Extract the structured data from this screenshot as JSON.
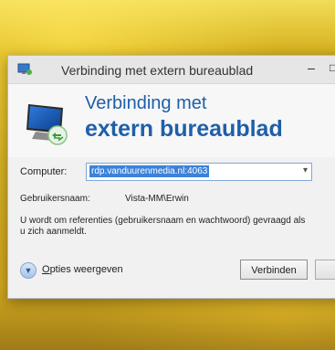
{
  "window": {
    "title": "Verbinding met extern bureaublad",
    "minimize_glyph": "–",
    "maximize_glyph": "□"
  },
  "banner": {
    "line1": "Verbinding met",
    "line2": "extern bureaublad",
    "icon": "remote-desktop-monitor-icon"
  },
  "form": {
    "computer_label": "Computer:",
    "computer_value": "rdp.vanduurenmedia.nl:4063",
    "username_label": "Gebruikersnaam:",
    "username_value": "Vista-MM\\Erwin",
    "info_text": "U wordt om referenties (gebruikersnaam en wachtwoord) gevraagd als u zich aanmeldt."
  },
  "footer": {
    "options_label_first": "O",
    "options_label_rest": "pties weergeven",
    "connect_label": "Verbinden"
  },
  "colors": {
    "accent": "#1f5fa9",
    "background": "#d9b61e",
    "selection": "#3b82d9"
  }
}
